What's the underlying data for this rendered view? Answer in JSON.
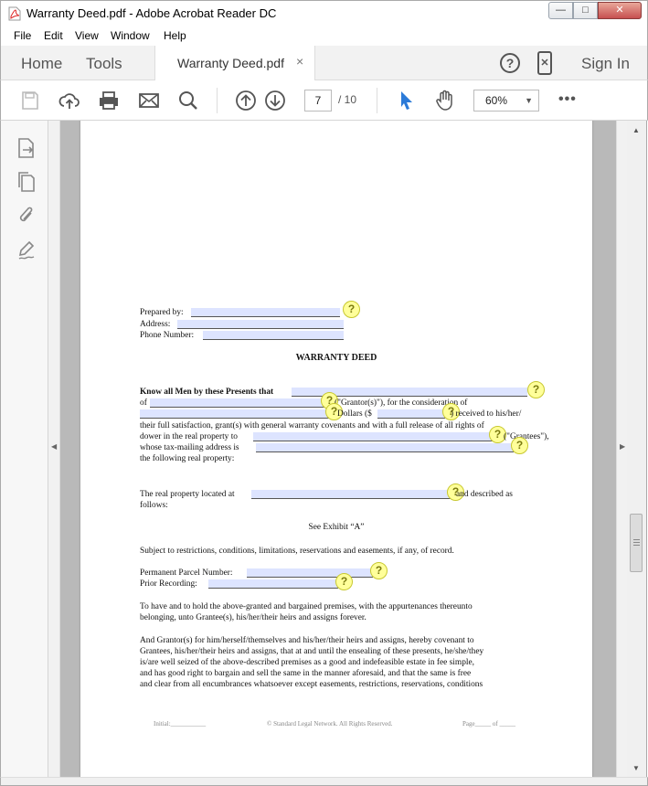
{
  "window": {
    "title": "Warranty Deed.pdf - Adobe Acrobat Reader DC",
    "minimize": "—",
    "maximize": "□",
    "close": "✕"
  },
  "menu": [
    "File",
    "Edit",
    "View",
    "Window",
    "Help"
  ],
  "nav": {
    "home": "Home",
    "tools": "Tools",
    "tab_label": "Warranty Deed.pdf",
    "tab_close": "×",
    "help": "?",
    "sign_in": "Sign In"
  },
  "toolbar": {
    "page_current": "7",
    "page_total": "/ 10",
    "zoom": "60%",
    "zoom_caret": "▼",
    "more": "•••",
    "icons": [
      "save-icon",
      "upload-icon",
      "print-icon",
      "email-icon",
      "search-icon",
      "page-up-icon",
      "page-down-icon",
      "select-cursor-icon",
      "hand-tool-icon"
    ]
  },
  "side_panel": {
    "icons": [
      "export-pdf-icon",
      "page-thumbnails-icon",
      "attachments-icon",
      "fill-sign-icon"
    ],
    "collapse_left": "◀",
    "collapse_right": "▶"
  },
  "scrollbar": {
    "up": "▲",
    "down": "▼"
  },
  "document": {
    "prepared_by": "Prepared by:",
    "address": "Address:",
    "phone": "Phone Number:",
    "title": "WARRANTY DEED",
    "know_all": "Know all Men by these Presents that",
    "of": "of",
    "grantors": "(\"Grantor(s)\"), for the consideration of",
    "dollars": "Dollars ($",
    "received": ") received to his/her/",
    "line4": "their full satisfaction, grant(s) with general warranty covenants and with a full release of all rights of",
    "dower": "dower in the real property to",
    "grantees": "(\"Grantees\"),",
    "whose": "whose tax-mailing address is",
    "following": "the following real property:",
    "located_at": "The real property located at",
    "described_as": "and described as",
    "follows": "follows:",
    "exhibit": "See Exhibit “A”",
    "subject": "Subject to restrictions, conditions, limitations, reservations and easements, if any, of record.",
    "parcel": "Permanent Parcel Number:",
    "prior": "Prior Recording:",
    "para1": [
      "To have and to hold the above-granted and bargained premises, with the appurtenances thereunto",
      "belonging, unto Grantee(s), his/her/their heirs and assigns forever."
    ],
    "para2": [
      "And Grantor(s) for him/herself/themselves and his/her/their heirs and assigns, hereby covenant to",
      "Grantees, his/her/their heirs and assigns, that at and until the ensealing of these presents, he/she/they",
      "is/are well seized of the above-described premises as a good and indefeasible estate in fee simple,",
      "and has good right to bargain and sell the same in the manner aforesaid, and that the same is free",
      "and clear from all encumbrances whatsoever except easements, restrictions, reservations, conditions"
    ],
    "hint_glyph": "?",
    "footer_initial": "Initial:___________",
    "footer_copyright": "© Standard Legal Network.  All Rights Reserved.",
    "footer_page": "Page_____ of _____"
  },
  "colors": {
    "field_fill": "#dde4ff",
    "hint_fill": "#ffff9a",
    "select_tool_blue": "#2b7ad8"
  }
}
